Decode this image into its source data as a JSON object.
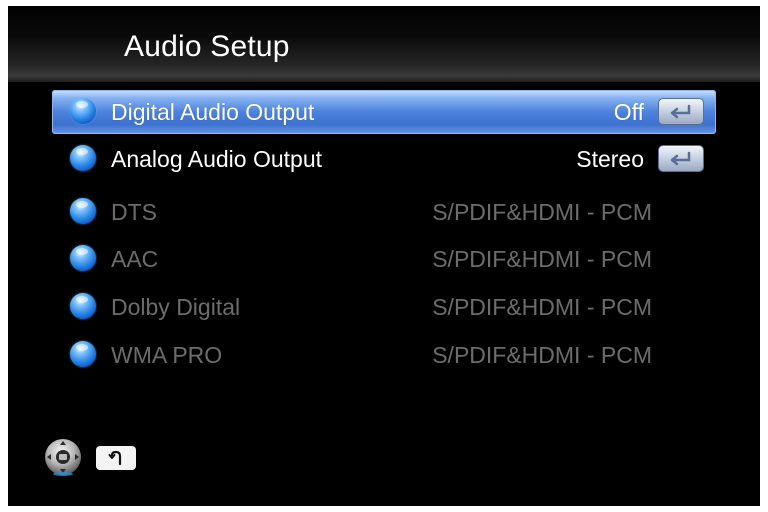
{
  "header": {
    "title": "Audio Setup"
  },
  "menu": {
    "items": [
      {
        "label": "Digital Audio Output",
        "value": "Off",
        "state": "selected",
        "icon": "enter-icon"
      },
      {
        "label": "Analog Audio Output",
        "value": "Stereo",
        "state": "enabled",
        "icon": "enter-icon"
      },
      {
        "label": "DTS",
        "value": "S/PDIF&HDMI - PCM",
        "state": "disabled"
      },
      {
        "label": "AAC",
        "value": "S/PDIF&HDMI - PCM",
        "state": "disabled"
      },
      {
        "label": "Dolby Digital",
        "value": "S/PDIF&HDMI - PCM",
        "state": "disabled"
      },
      {
        "label": "WMA PRO",
        "value": "S/PDIF&HDMI - PCM",
        "state": "disabled"
      }
    ]
  },
  "footer": {
    "nav_icon": "dpad-icon",
    "back_icon": "return-icon"
  },
  "colors": {
    "background": "#000000",
    "selection": "#4d82dd",
    "text": "#ffffff",
    "disabled_text": "#6c6c6c",
    "bullet": "#2a86e6"
  }
}
